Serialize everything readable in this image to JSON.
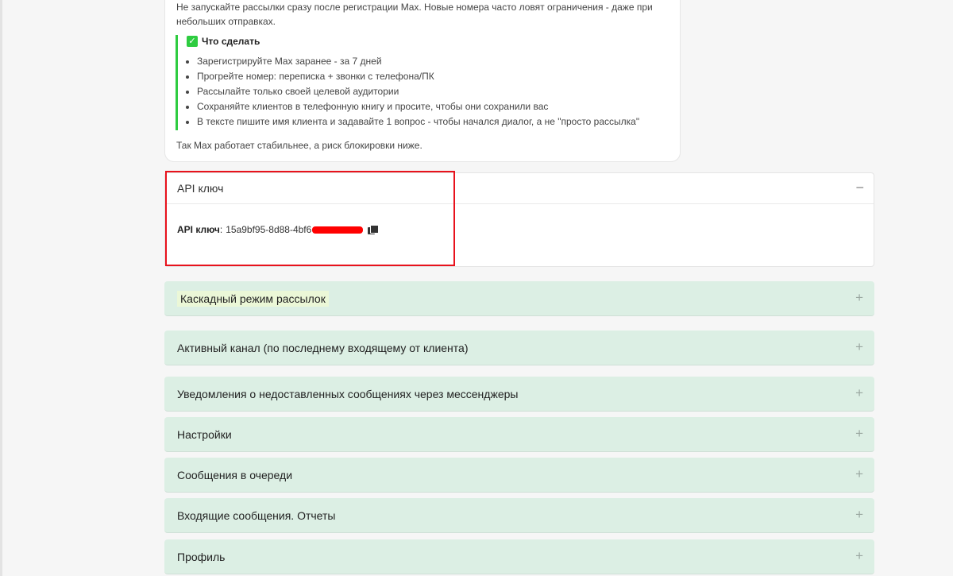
{
  "info": {
    "intro": "Не запускайте рассылки сразу после регистрации Max. Новые номера часто ловят ограничения - даже при небольших отправках.",
    "callout_title": "Что сделать",
    "items": [
      "Зарегистрируйте Max заранее - за 7 дней",
      "Прогрейте номер: переписка + звонки с телефона/ПК",
      "Рассылайте только своей целевой аудитории",
      "Сохраняйте клиентов в телефонную книгу и просите, чтобы они сохранили вас",
      "В тексте пишите имя клиента и задавайте 1 вопрос - чтобы начался диалог, а не \"просто рассылка\""
    ],
    "outro": "Так Max работает стабильнее, а риск блокировки ниже."
  },
  "api": {
    "title": "API ключ",
    "collapse_symbol": "−",
    "key_label": "API ключ",
    "key_sep": ":",
    "key_value": "15a9bf95-8d88-4bf6"
  },
  "accordions": [
    {
      "label": "Каскадный режим рассылок",
      "highlighted": true
    },
    {
      "label": "Активный канал (по последнему входящему от клиента)"
    },
    {
      "label": "Уведомления о недоставленных сообщениях через мессенджеры"
    },
    {
      "label": "Настройки"
    },
    {
      "label": "Сообщения в очереди"
    },
    {
      "label": "Входящие сообщения. Отчеты"
    },
    {
      "label": "Профиль"
    }
  ],
  "icons": {
    "check": "check-square-icon",
    "copy": "copy-icon",
    "expand": "plus-icon",
    "collapse": "minus-icon"
  },
  "colors": {
    "accent_green": "#2ecc40",
    "accordion_bg": "#dcefe4",
    "highlight_red": "#e8121c",
    "redaction": "#ff0000"
  },
  "symbols": {
    "plus": "+",
    "check": "✓"
  }
}
